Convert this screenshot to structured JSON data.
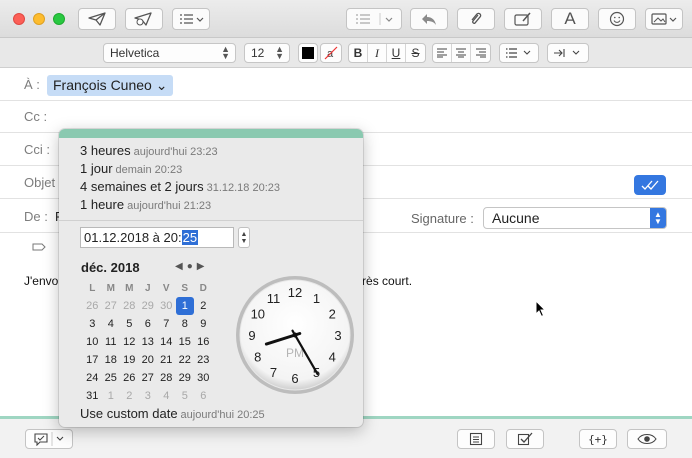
{
  "header": {
    "to_label": "À :",
    "to_recipient": "François Cuneo ⌄",
    "cc_label": "Cc :",
    "bcc_label": "Cci :",
    "subject_label": "Objet",
    "from_label": "De :",
    "from_value_partial": "F",
    "signature_label": "Signature :",
    "signature_value": "Aucune"
  },
  "format": {
    "font": "Helvetica",
    "size": "12"
  },
  "body": {
    "text_left": "J'envo",
    "text_right": "délai très court."
  },
  "send_later": {
    "options": [
      {
        "label": "3 heures",
        "sub": "aujourd'hui 23:23"
      },
      {
        "label": "1 jour",
        "sub": "demain 20:23"
      },
      {
        "label": "4 semaines et 2 jours",
        "sub": "31.12.18 20:23"
      },
      {
        "label": "1 heure",
        "sub": "aujourd'hui 21:23"
      }
    ],
    "datetime_prefix": "01.12.2018 à 20:",
    "datetime_selected": "25",
    "month_label": "déc. 2018",
    "weekdays": [
      "L",
      "M",
      "M",
      "J",
      "V",
      "S",
      "D"
    ],
    "weeks": [
      [
        "26",
        "27",
        "28",
        "29",
        "30",
        "1",
        "2"
      ],
      [
        "3",
        "4",
        "5",
        "6",
        "7",
        "8",
        "9"
      ],
      [
        "10",
        "11",
        "12",
        "13",
        "14",
        "15",
        "16"
      ],
      [
        "17",
        "18",
        "19",
        "20",
        "21",
        "22",
        "23"
      ],
      [
        "24",
        "25",
        "26",
        "27",
        "28",
        "29",
        "30"
      ],
      [
        "31",
        "1",
        "2",
        "3",
        "4",
        "5",
        "6"
      ]
    ],
    "selected_day": "1",
    "clock_period": "PM",
    "custom_label": "Use custom date",
    "custom_sub": "aujourd'hui 20:25"
  },
  "colors": {
    "accent": "#2f6fd6",
    "band": "#8ac9b0"
  }
}
